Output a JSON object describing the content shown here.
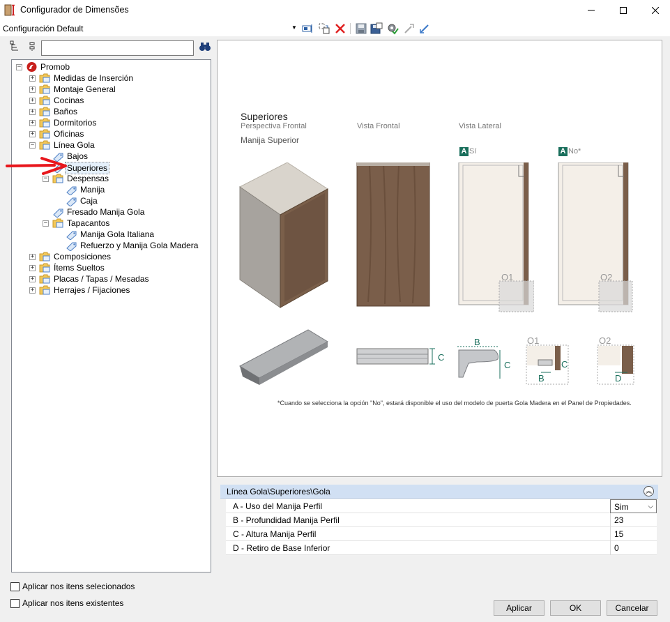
{
  "window": {
    "title": "Configurador de Dimensões",
    "minimize_icon": "minimize-icon",
    "maximize_icon": "maximize-icon",
    "close_icon": "close-icon"
  },
  "toolbar": {
    "configuration_value": "Configuración Default",
    "icons": [
      "dropdown-arrow-icon",
      "add-config-icon",
      "copy-config-icon",
      "delete-icon",
      "save-icon",
      "save-as-icon",
      "settings-icon",
      "export-icon",
      "import-icon"
    ],
    "delete_color": "#e02020"
  },
  "search": {
    "value": "",
    "placeholder": ""
  },
  "tree": {
    "items": [
      {
        "label": "Promob",
        "level": 0,
        "expanded": true,
        "icon": "promob-logo-icon"
      },
      {
        "label": "Medidas de Inserción",
        "level": 1,
        "expanded": false,
        "icon": "folder-icon"
      },
      {
        "label": "Montaje General",
        "level": 1,
        "expanded": false,
        "icon": "folder-icon"
      },
      {
        "label": "Cocinas",
        "level": 1,
        "expanded": false,
        "icon": "folder-icon"
      },
      {
        "label": "Baños",
        "level": 1,
        "expanded": false,
        "icon": "folder-icon"
      },
      {
        "label": "Dormitorios",
        "level": 1,
        "expanded": false,
        "icon": "folder-icon"
      },
      {
        "label": "Oficinas",
        "level": 1,
        "expanded": false,
        "icon": "folder-icon"
      },
      {
        "label": "Línea Gola",
        "level": 1,
        "expanded": true,
        "icon": "folder-icon"
      },
      {
        "label": "Bajos",
        "level": 2,
        "icon": "tag-icon"
      },
      {
        "label": "Superiores",
        "level": 2,
        "icon": "tag-icon",
        "selected": true
      },
      {
        "label": "Despensas",
        "level": 2,
        "expanded": true,
        "icon": "folder-icon"
      },
      {
        "label": "Manija",
        "level": 3,
        "icon": "tag-icon"
      },
      {
        "label": "Caja",
        "level": 3,
        "icon": "tag-icon"
      },
      {
        "label": "Fresado Manija Gola",
        "level": 2,
        "icon": "tag-icon"
      },
      {
        "label": "Tapacantos",
        "level": 2,
        "expanded": true,
        "icon": "folder-icon"
      },
      {
        "label": "Manija Gola Italiana",
        "level": 3,
        "icon": "tag-icon"
      },
      {
        "label": "Refuerzo y Manija Gola Madera",
        "level": 3,
        "icon": "tag-icon"
      },
      {
        "label": "Composiciones",
        "level": 1,
        "expanded": false,
        "icon": "folder-icon"
      },
      {
        "label": "Ítems Sueltos",
        "level": 1,
        "expanded": false,
        "icon": "folder-icon"
      },
      {
        "label": "Placas / Tapas / Mesadas",
        "level": 1,
        "expanded": false,
        "icon": "folder-icon"
      },
      {
        "label": "Herrajes / Fijaciones",
        "level": 1,
        "expanded": false,
        "icon": "folder-icon"
      }
    ]
  },
  "preview": {
    "title": "Superiores",
    "col_perspectiva": "Perspectiva Frontal",
    "col_frontal": "Vista Frontal",
    "col_lateral": "Vista Lateral",
    "subtitle": "Manija Superior",
    "option_a_yes": "Sí",
    "option_a_no": "No*",
    "badge_letter": "A",
    "detail_o1": "O1",
    "detail_o2": "O2",
    "dim_b": "B",
    "dim_c": "C",
    "dim_d": "D",
    "footnote": "*Cuando se selecciona la opción \"No\", estará disponible el uso del modelo de puerta Gola Madera en el Panel de Propiedades.",
    "accent_color": "#1a6f5c"
  },
  "properties": {
    "path": "Línea Gola\\Superiores\\Gola",
    "rows": [
      {
        "name": "A - Uso del Manija Perfil",
        "value": "Sim"
      },
      {
        "name": "B - Profundidad Manija Perfil",
        "value": "23"
      },
      {
        "name": "C - Altura Manija Perfil",
        "value": "15"
      },
      {
        "name": "D - Retiro de Base Inferior",
        "value": "0"
      }
    ]
  },
  "options": {
    "apply_selected": "Aplicar nos itens selecionados",
    "apply_existing": "Aplicar nos itens existentes"
  },
  "buttons": {
    "apply": "Aplicar",
    "ok": "OK",
    "cancel": "Cancelar"
  }
}
